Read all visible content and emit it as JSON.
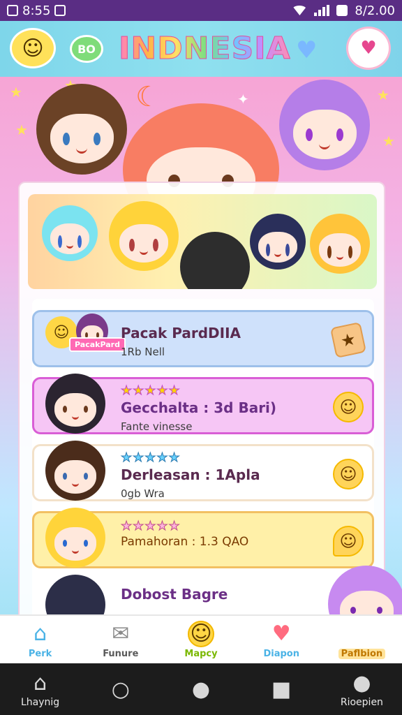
{
  "status": {
    "time": "8:55",
    "battery": "8/2.00"
  },
  "header": {
    "title": "INDNESIA",
    "badge_text": "BO"
  },
  "list": [
    {
      "name": "Pacak PardDIIA",
      "sub": "1Rb  Nell",
      "tag": "Pacak\nPardio",
      "color": "#cfe1fb",
      "border": "#9dc0ea",
      "stars": ""
    },
    {
      "name": "Gecchalta : 3d Bari)",
      "sub": "Fante vinesse",
      "color": "#f6c6f5",
      "border": "#d95ed6",
      "stars": "★★★★★"
    },
    {
      "name": "Derleasan : 1Apla",
      "sub": "0gb  Wra",
      "color": "#ffffff",
      "border": "#f3e1c9",
      "stars": "★★★★★"
    },
    {
      "name": "Pamahoran : 1.3 QAO",
      "sub": "",
      "color": "#fff0a8",
      "border": "#f2c062",
      "stars": "★★★★★"
    },
    {
      "name": "Dobost Bagre",
      "sub": "",
      "color": "#ffffff",
      "border": "#ffffff",
      "stars": ""
    }
  ],
  "appnav": {
    "tabs": [
      {
        "label": "Perk",
        "color": "#4bb3e6"
      },
      {
        "label": "Funure",
        "color": "#5a5a5a"
      },
      {
        "label": "Mapcy",
        "color": "#7ab800"
      },
      {
        "label": "Diapon",
        "color": "#4bb3e6"
      },
      {
        "label": "Paflbion",
        "color": "#c07800"
      }
    ]
  },
  "sysnav": {
    "tabs": [
      {
        "label": "Lhaynig"
      },
      {
        "label": ""
      },
      {
        "label": ""
      },
      {
        "label": ""
      },
      {
        "label": "Rioepien"
      }
    ]
  }
}
